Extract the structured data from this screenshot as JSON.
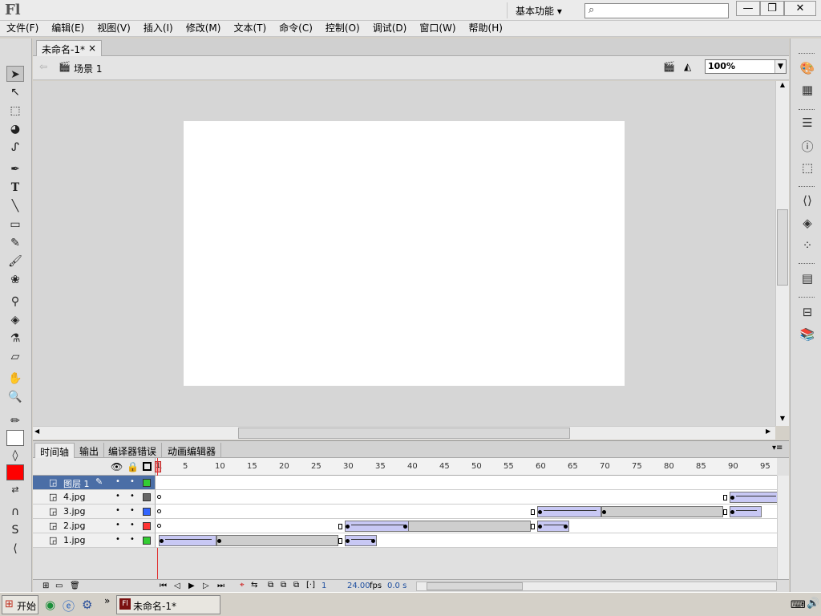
{
  "titlebar": {
    "logo": "Fl",
    "workspace": "基本功能 ▾",
    "search_icon": "search-icon",
    "min": "—",
    "max": "❐",
    "close": "✕"
  },
  "menu": [
    "文件(F)",
    "编辑(E)",
    "视图(V)",
    "插入(I)",
    "修改(M)",
    "文本(T)",
    "命令(C)",
    "控制(O)",
    "调试(D)",
    "窗口(W)",
    "帮助(H)"
  ],
  "document": {
    "tab": "未命名-1*",
    "tab_close": "×",
    "scene": "场景 1",
    "zoom": "100%"
  },
  "timeline": {
    "tabs": [
      "时间轴",
      "输出",
      "编译器错误",
      "动画编辑器"
    ],
    "ruler": [
      "1",
      "5",
      "10",
      "15",
      "20",
      "25",
      "30",
      "35",
      "40",
      "45",
      "50",
      "55",
      "60",
      "65",
      "70",
      "75",
      "80",
      "85",
      "90",
      "95"
    ],
    "layers": [
      {
        "name": "图层 1",
        "color": "#33cc33",
        "selected": true
      },
      {
        "name": "4.jpg",
        "color": "#666666",
        "selected": false
      },
      {
        "name": "3.jpg",
        "color": "#3366ff",
        "selected": false
      },
      {
        "name": "2.jpg",
        "color": "#ff3333",
        "selected": false
      },
      {
        "name": "1.jpg",
        "color": "#33cc33",
        "selected": false
      }
    ],
    "status": {
      "frame": "1",
      "fps": "24.00",
      "fps_unit": "fps",
      "time": "0.0 s"
    }
  },
  "taskbar": {
    "start": "开始",
    "task": "未命名-1*"
  }
}
